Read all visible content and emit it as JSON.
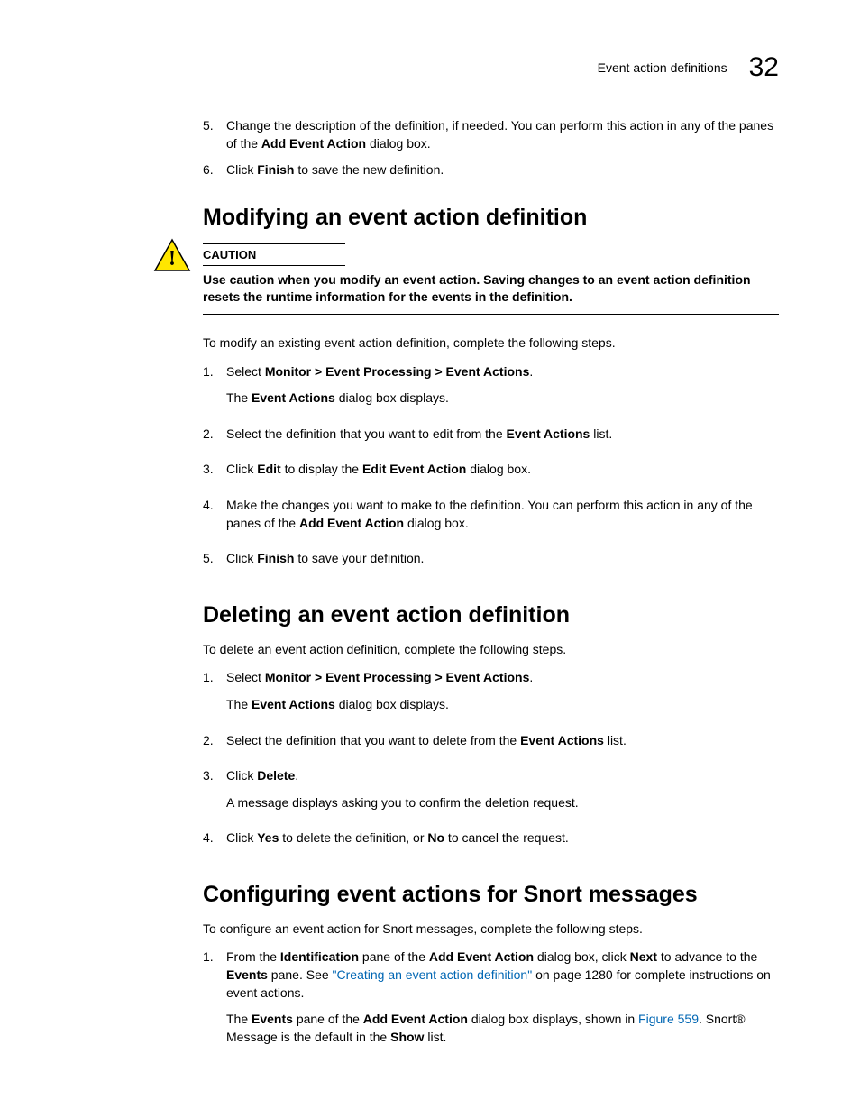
{
  "header": {
    "section_label": "Event action definitions",
    "chapter_number": "32"
  },
  "top_steps": [
    {
      "num": "5.",
      "text_before": "Change the description of the definition, if needed. You can perform this action in any of the panes of the ",
      "bold1": "Add Event Action",
      "text_after": " dialog box."
    },
    {
      "num": "6.",
      "text_before": "Click ",
      "bold1": "Finish",
      "text_after": " to save the new definition."
    }
  ],
  "section1": {
    "title": "Modifying an event action definition",
    "caution_label": "CAUTION",
    "caution_text": "Use caution when you modify an event action. Saving changes to an event action definition resets the runtime information for the events in the definition.",
    "intro": "To modify an existing event action definition, complete the following steps.",
    "steps": [
      {
        "num": "1.",
        "parts": [
          {
            "t": "Select "
          },
          {
            "t": "Monitor > Event Processing > Event Actions",
            "b": true
          },
          {
            "t": "."
          }
        ],
        "sub": [
          {
            "t": "The "
          },
          {
            "t": "Event Actions",
            "b": true
          },
          {
            "t": " dialog box displays."
          }
        ]
      },
      {
        "num": "2.",
        "parts": [
          {
            "t": "Select the definition that you want to edit from the "
          },
          {
            "t": "Event Actions",
            "b": true
          },
          {
            "t": " list."
          }
        ]
      },
      {
        "num": "3.",
        "parts": [
          {
            "t": "Click "
          },
          {
            "t": "Edit",
            "b": true
          },
          {
            "t": " to display the "
          },
          {
            "t": "Edit Event Action",
            "b": true
          },
          {
            "t": " dialog box."
          }
        ]
      },
      {
        "num": "4.",
        "parts": [
          {
            "t": "Make the changes you want to make to the definition. You can perform this action in any of the panes of the "
          },
          {
            "t": "Add Event Action",
            "b": true
          },
          {
            "t": " dialog box."
          }
        ]
      },
      {
        "num": "5.",
        "parts": [
          {
            "t": "Click "
          },
          {
            "t": "Finish",
            "b": true
          },
          {
            "t": " to save your definition."
          }
        ]
      }
    ]
  },
  "section2": {
    "title": "Deleting an event action definition",
    "intro": "To delete an event action definition, complete the following steps.",
    "steps": [
      {
        "num": "1.",
        "parts": [
          {
            "t": "Select "
          },
          {
            "t": "Monitor > Event Processing > Event Actions",
            "b": true
          },
          {
            "t": "."
          }
        ],
        "sub": [
          {
            "t": "The "
          },
          {
            "t": "Event Actions",
            "b": true
          },
          {
            "t": " dialog box displays."
          }
        ]
      },
      {
        "num": "2.",
        "parts": [
          {
            "t": "Select the definition that you want to delete from the "
          },
          {
            "t": "Event Actions",
            "b": true
          },
          {
            "t": " list."
          }
        ]
      },
      {
        "num": "3.",
        "parts": [
          {
            "t": "Click "
          },
          {
            "t": "Delete",
            "b": true
          },
          {
            "t": "."
          }
        ],
        "sub": [
          {
            "t": "A message displays asking you to confirm the deletion request."
          }
        ]
      },
      {
        "num": "4.",
        "parts": [
          {
            "t": "Click "
          },
          {
            "t": "Yes",
            "b": true
          },
          {
            "t": " to delete the definition, or "
          },
          {
            "t": "No",
            "b": true
          },
          {
            "t": " to cancel the request."
          }
        ]
      }
    ]
  },
  "section3": {
    "title": "Configuring event actions for Snort messages",
    "intro": "To configure an event action for Snort messages, complete the following steps.",
    "steps": [
      {
        "num": "1.",
        "parts": [
          {
            "t": "From the "
          },
          {
            "t": "Identification",
            "b": true
          },
          {
            "t": " pane of the "
          },
          {
            "t": "Add Event Action",
            "b": true
          },
          {
            "t": " dialog box, click "
          },
          {
            "t": "Next",
            "b": true
          },
          {
            "t": " to advance to the "
          },
          {
            "t": "Events",
            "b": true
          },
          {
            "t": " pane. See "
          },
          {
            "t": "\"Creating an event action definition\"",
            "link": true
          },
          {
            "t": " on page 1280 for complete instructions on event actions."
          }
        ],
        "sub": [
          {
            "t": "The "
          },
          {
            "t": "Events",
            "b": true
          },
          {
            "t": " pane of the "
          },
          {
            "t": "Add Event Action",
            "b": true
          },
          {
            "t": " dialog box displays, shown in "
          },
          {
            "t": "Figure 559",
            "link": true
          },
          {
            "t": ". Snort® Message is the default in the "
          },
          {
            "t": "Show",
            "b": true
          },
          {
            "t": " list."
          }
        ]
      }
    ]
  }
}
